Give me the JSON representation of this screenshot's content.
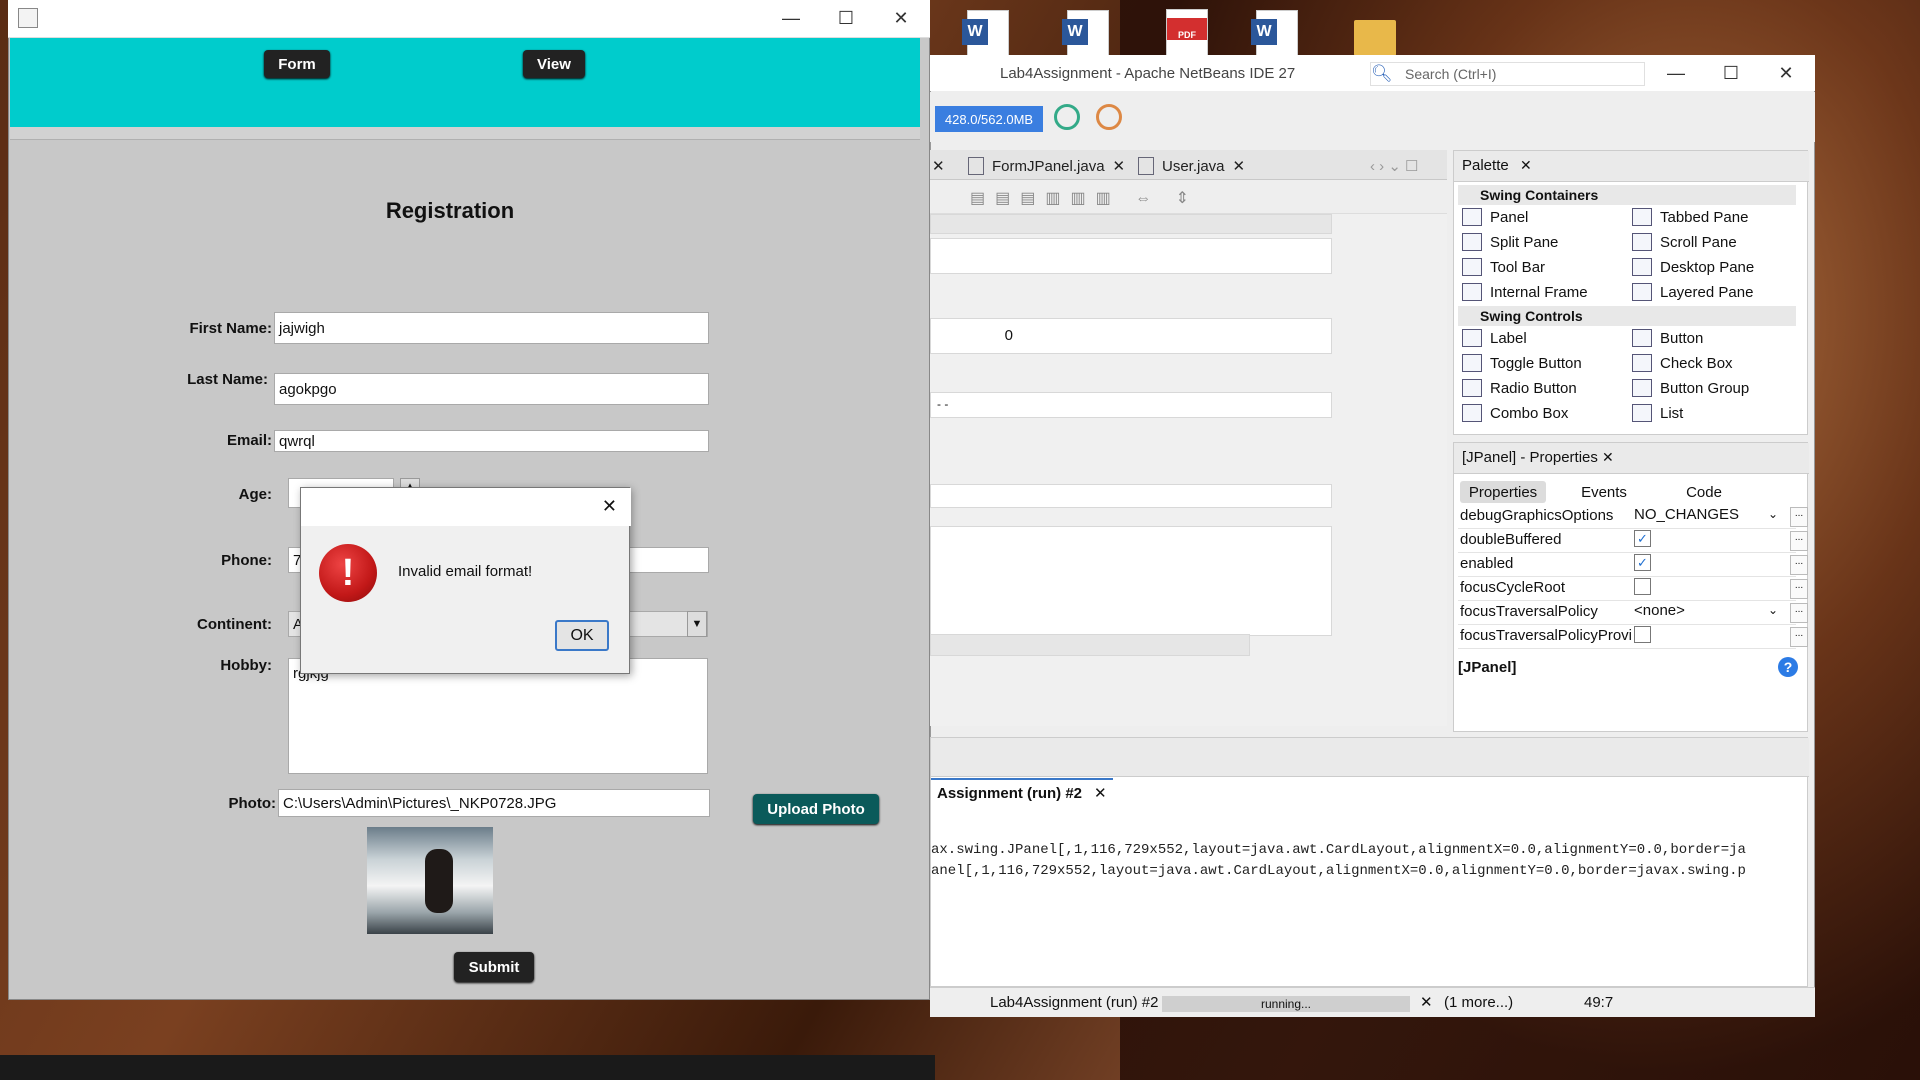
{
  "desktop": {
    "icons": [
      "word-doc-icon",
      "word-doc-icon",
      "pdf-icon",
      "word-doc-icon",
      "folder-icon"
    ],
    "icon_labels": {
      "word": "W",
      "pdf": "PDF"
    }
  },
  "ide": {
    "title": "Lab4Assignment - Apache NetBeans IDE 27",
    "search_placeholder": "Search (Ctrl+I)",
    "memory": "428.0/562.0MB",
    "editor_tabs": [
      "FormJPanel.java",
      "User.java"
    ],
    "spinner_value": "0",
    "small_text": "-   -",
    "palette": {
      "title": "Palette",
      "categories": [
        {
          "name": "Swing Containers",
          "items": [
            "Panel",
            "Tabbed Pane",
            "Split Pane",
            "Scroll Pane",
            "Tool Bar",
            "Desktop Pane",
            "Internal Frame",
            "Layered Pane"
          ]
        },
        {
          "name": "Swing Controls",
          "items": [
            "Label",
            "Button",
            "Toggle Button",
            "Check Box",
            "Radio Button",
            "Button Group",
            "Combo Box",
            "List"
          ]
        }
      ]
    },
    "properties": {
      "title": "[JPanel] - Properties",
      "tabs": [
        "Properties",
        "Events",
        "Code"
      ],
      "rows": [
        {
          "key": "debugGraphicsOptions",
          "value": "NO_CHANGES"
        },
        {
          "key": "doubleBuffered",
          "value": "✓"
        },
        {
          "key": "enabled",
          "value": "✓"
        },
        {
          "key": "focusCycleRoot",
          "value": ""
        },
        {
          "key": "focusTraversalPolicy",
          "value": "<none>"
        },
        {
          "key": "focusTraversalPolicyProvi",
          "value": ""
        }
      ],
      "footer": "[JPanel]"
    },
    "output": {
      "tab": "Assignment (run) #2",
      "lines": [
        "ax.swing.JPanel[,1,116,729x552,layout=java.awt.CardLayout,alignmentX=0.0,alignmentY=0.0,border=ja",
        "anel[,1,116,729x552,layout=java.awt.CardLayout,alignmentX=0.0,alignmentY=0.0,border=javax.swing.p"
      ]
    },
    "status": {
      "task": "Lab4Assignment (run) #2",
      "progress": "running...",
      "more": "(1 more...)",
      "position": "49:7"
    }
  },
  "app": {
    "nav": {
      "form": "Form",
      "view": "View"
    },
    "title": "Registration",
    "labels": {
      "first_name": "First Name:",
      "last_name": "Last Name:",
      "email": "Email:",
      "age": "Age:",
      "phone": "Phone:",
      "continent": "Continent:",
      "hobby": "Hobby:",
      "photo": "Photo:"
    },
    "values": {
      "first_name": "jajwigh",
      "last_name": "agokpgo",
      "email": "qwrql",
      "phone": "7",
      "continent": "A",
      "hobby": "rgjkjg",
      "photo_path": "C:\\Users\\Admin\\Pictures\\_NKP0728.JPG"
    },
    "upload_button": "Upload Photo",
    "submit_button": "Submit"
  },
  "dialog": {
    "message": "Invalid email format!",
    "ok": "OK"
  }
}
